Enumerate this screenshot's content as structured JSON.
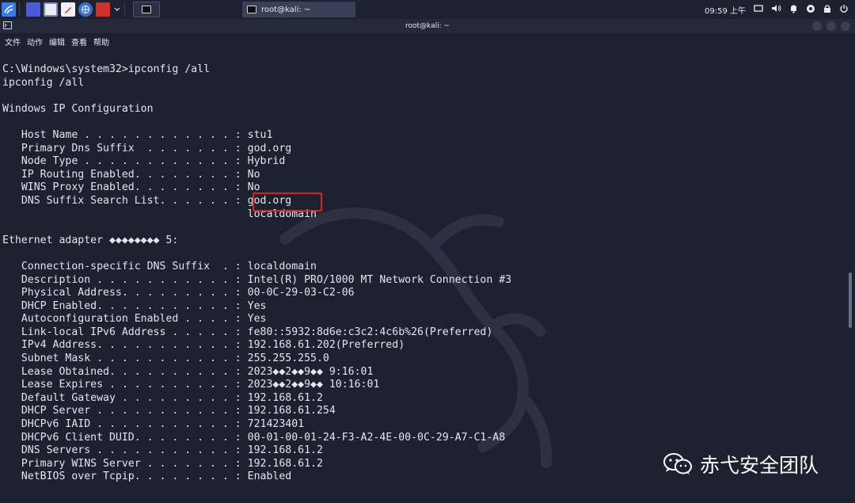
{
  "taskbar": {
    "clock": "09:59 上午",
    "task_title": "root@kali: ~"
  },
  "window": {
    "title": "root@kali: ~"
  },
  "menu": [
    "文件",
    "动作",
    "编辑",
    "查看",
    "帮助"
  ],
  "terminal": {
    "lines": [
      "C:\\Windows\\system32>ipconfig /all",
      "ipconfig /all",
      "",
      "Windows IP Configuration",
      "",
      "   Host Name . . . . . . . . . . . . : stu1",
      "   Primary Dns Suffix  . . . . . . . : god.org",
      "   Node Type . . . . . . . . . . . . : Hybrid",
      "   IP Routing Enabled. . . . . . . . : No",
      "   WINS Proxy Enabled. . . . . . . . : No",
      "   DNS Suffix Search List. . . . . . : god.org",
      "                                       localdomain",
      "",
      "Ethernet adapter ◆◆◆◆◆◆◆◆ 5:",
      "",
      "   Connection-specific DNS Suffix  . : localdomain",
      "   Description . . . . . . . . . . . : Intel(R) PRO/1000 MT Network Connection #3",
      "   Physical Address. . . . . . . . . : 00-0C-29-03-C2-06",
      "   DHCP Enabled. . . . . . . . . . . : Yes",
      "   Autoconfiguration Enabled . . . . : Yes",
      "   Link-local IPv6 Address . . . . . : fe80::5932:8d6e:c3c2:4c6b%26(Preferred)",
      "   IPv4 Address. . . . . . . . . . . : 192.168.61.202(Preferred)",
      "   Subnet Mask . . . . . . . . . . . : 255.255.255.0",
      "   Lease Obtained. . . . . . . . . . : 2023◆◆2◆◆9◆◆ 9:16:01",
      "   Lease Expires . . . . . . . . . . : 2023◆◆2◆◆9◆◆ 10:16:01",
      "   Default Gateway . . . . . . . . . : 192.168.61.2",
      "   DHCP Server . . . . . . . . . . . : 192.168.61.254",
      "   DHCPv6 IAID . . . . . . . . . . . : 721423401",
      "   DHCPv6 Client DUID. . . . . . . . : 00-01-00-01-24-F3-A2-4E-00-0C-29-A7-C1-A8",
      "   DNS Servers . . . . . . . . . . . : 192.168.61.2",
      "   Primary WINS Server . . . . . . . : 192.168.61.2",
      "   NetBIOS over Tcpip. . . . . . . . : Enabled"
    ]
  },
  "watermark": {
    "text": "赤弋安全团队"
  },
  "colors": {
    "background": "#1d2130",
    "text": "#e3e6ee",
    "highlight_box": "#e02020"
  }
}
